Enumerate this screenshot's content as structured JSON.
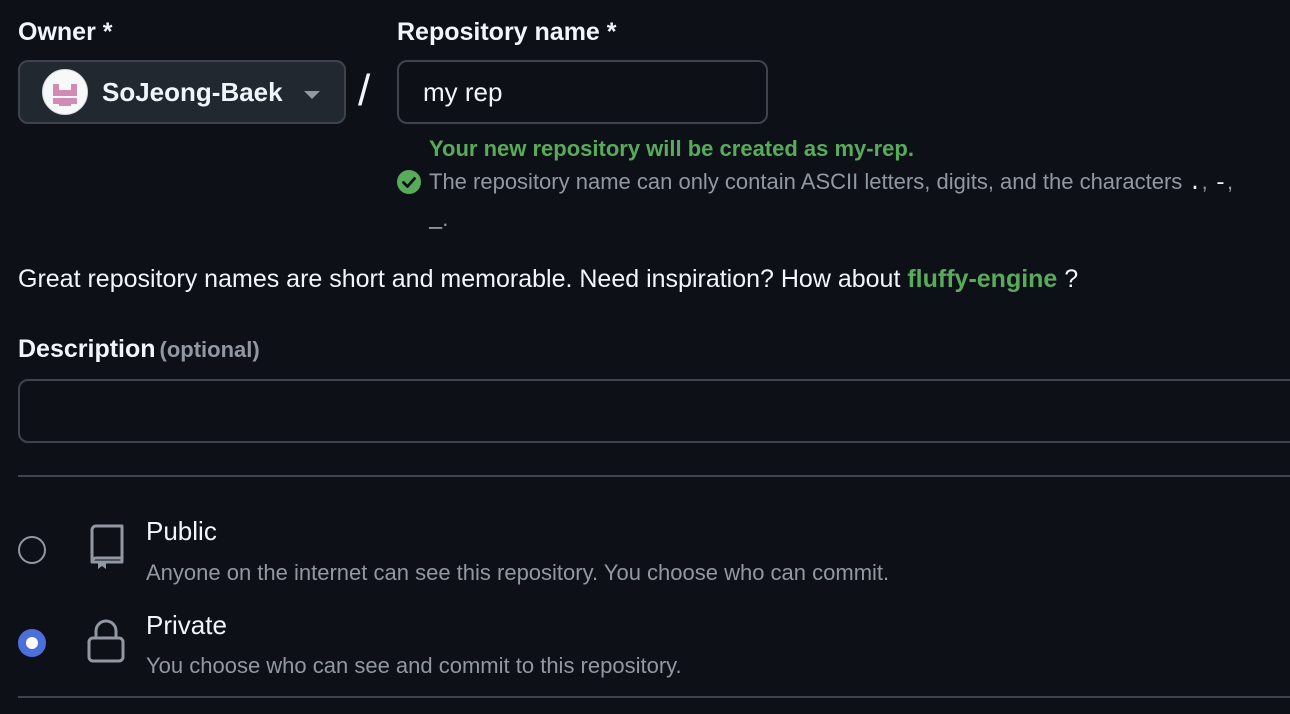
{
  "owner": {
    "label": "Owner *",
    "name": "SoJeong-Baek"
  },
  "separator": "/",
  "repository": {
    "label": "Repository name *",
    "value": "my rep",
    "success_message": "Your new repository will be created as my-rep.",
    "hint_prefix": "The repository name can only contain ASCII letters, digits, and the characters ",
    "hint_chars": ".",
    "hint_sep1": ", ",
    "hint_chars2": "-",
    "hint_sep2": ",",
    "hint_chars3": "_",
    "hint_end": "."
  },
  "suggestion": {
    "prefix": "Great repository names are short and memorable. Need inspiration? How about ",
    "name": "fluffy-engine",
    "suffix": " ?"
  },
  "description": {
    "label": "Description",
    "optional": "(optional)",
    "value": ""
  },
  "visibility": {
    "options": [
      {
        "title": "Public",
        "description": "Anyone on the internet can see this repository. You choose who can commit.",
        "icon": "repo-icon",
        "selected": false
      },
      {
        "title": "Private",
        "description": "You choose who can see and commit to this repository.",
        "icon": "lock-icon",
        "selected": true
      }
    ]
  },
  "colors": {
    "background": "#0d1117",
    "success": "#57ab5a",
    "accent": "#4c6fdc",
    "muted": "#9198a1",
    "border": "#3d444d"
  }
}
